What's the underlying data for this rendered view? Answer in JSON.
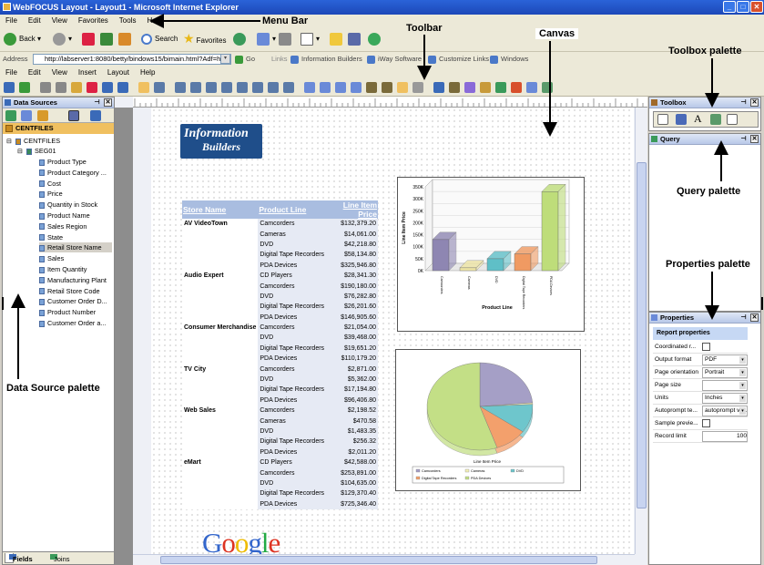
{
  "window": {
    "title": "WebFOCUS Layout - Layout1 - Microsoft Internet Explorer"
  },
  "ie_menu": [
    "File",
    "Edit",
    "View",
    "Favorites",
    "Tools",
    "Help"
  ],
  "ie_toolbar": {
    "back": "Back",
    "search": "Search",
    "favorites": "Favorites"
  },
  "address": {
    "label": "Address",
    "url": "http://labserver1:8080/betty/bindows15/bimain.html?Adf=ht",
    "go": "Go",
    "links_label": "Links",
    "links": [
      "Information Builders",
      "iWay Software",
      "Customize Links",
      "Windows"
    ]
  },
  "app_menu": [
    "File",
    "Edit",
    "View",
    "Insert",
    "Layout",
    "Help"
  ],
  "data_sources": {
    "title": "Data Sources",
    "root": "CENTFILES",
    "tree_root": "CENTFILES",
    "segment": "SEG01",
    "fields": [
      "Product Type",
      "Product Category ...",
      "Cost",
      "Price",
      "Quantity in Stock",
      "Product Name",
      "Sales Region",
      "State",
      "Retail Store Name",
      "Sales",
      "Item Quantity",
      "Manufacturing Plant",
      "Retail Store Code",
      "Customer Order D...",
      "Product Number",
      "Customer Order a..."
    ],
    "selected": "Retail Store Name",
    "tabs": [
      "Fields",
      "Joins"
    ]
  },
  "canvas": {
    "logo": {
      "line1": "Information",
      "line2": "Builders"
    },
    "google_logo": "Google",
    "report": {
      "headers": [
        "Store Name",
        "Product Line",
        "Line Item Price"
      ],
      "rows": [
        [
          "AV VideoTown",
          "Camcorders",
          "$132,379.20"
        ],
        [
          "",
          "Cameras",
          "$14,061.00"
        ],
        [
          "",
          "DVD",
          "$42,218.80"
        ],
        [
          "",
          "Digital Tape Recorders",
          "$58,134.80"
        ],
        [
          "",
          "PDA Devices",
          "$325,946.80"
        ],
        [
          "Audio Expert",
          "CD Players",
          "$28,341.30"
        ],
        [
          "",
          "Camcorders",
          "$190,180.00"
        ],
        [
          "",
          "DVD",
          "$76,282.80"
        ],
        [
          "",
          "Digital Tape Recorders",
          "$26,201.60"
        ],
        [
          "",
          "PDA Devices",
          "$146,905.60"
        ],
        [
          "Consumer Merchandise",
          "Camcorders",
          "$21,054.00"
        ],
        [
          "",
          "DVD",
          "$39,468.00"
        ],
        [
          "",
          "Digital Tape Recorders",
          "$19,651.20"
        ],
        [
          "",
          "PDA Devices",
          "$110,179.20"
        ],
        [
          "TV City",
          "Camcorders",
          "$2,871.00"
        ],
        [
          "",
          "DVD",
          "$5,362.00"
        ],
        [
          "",
          "Digital Tape Recorders",
          "$17,194.80"
        ],
        [
          "",
          "PDA Devices",
          "$96,406.80"
        ],
        [
          "Web Sales",
          "Camcorders",
          "$2,198.52"
        ],
        [
          "",
          "Cameras",
          "$470.58"
        ],
        [
          "",
          "DVD",
          "$1,483.35"
        ],
        [
          "",
          "Digital Tape Recorders",
          "$256.32"
        ],
        [
          "",
          "PDA Devices",
          "$2,011.20"
        ],
        [
          "eMart",
          "CD Players",
          "$42,588.00"
        ],
        [
          "",
          "Camcorders",
          "$253,891.00"
        ],
        [
          "",
          "DVD",
          "$104,635.00"
        ],
        [
          "",
          "Digital Tape Recorders",
          "$129,370.40"
        ],
        [
          "",
          "PDA Devices",
          "$725,346.40"
        ]
      ]
    }
  },
  "chart_data": [
    {
      "type": "bar",
      "categories": [
        "Camcorders",
        "Cameras",
        "DVD",
        "Digital Tape Recorders",
        "PDA Devices"
      ],
      "values": [
        130000,
        12000,
        50000,
        70000,
        330000
      ],
      "xlabel": "Product Line",
      "ylabel": "Line Item Price",
      "ylim": [
        0,
        350000
      ],
      "ticks": [
        "0K",
        "50K",
        "100K",
        "150K",
        "200K",
        "250K",
        "300K",
        "350K"
      ],
      "colors": [
        "#8e86b2",
        "#efe6a6",
        "#5fbfc7",
        "#f09a62",
        "#bedd7a"
      ]
    },
    {
      "type": "pie",
      "title": "Line Item Price",
      "categories": [
        "Camcorders",
        "Cameras",
        "DVD",
        "Digital Tape Recorders",
        "PDA Devices"
      ],
      "values": [
        602574,
        14532,
        269450,
        250809,
        1406796
      ],
      "legend": [
        "Camcorders",
        "Cameras",
        "DVD",
        "Digital Tape Recorders",
        "PDA Devices"
      ],
      "colors": [
        "#a59fc6",
        "#f4f0b8",
        "#6ec6cc",
        "#f3a06c",
        "#c3df86"
      ]
    }
  ],
  "toolbox": {
    "title": "Toolbox"
  },
  "query": {
    "title": "Query"
  },
  "properties": {
    "title": "Properties",
    "section": "Report properties",
    "rows": [
      {
        "label": "Coordinated r...",
        "value": ""
      },
      {
        "label": "Output format",
        "value": "PDF"
      },
      {
        "label": "Page orientation",
        "value": "Portrait"
      },
      {
        "label": "Page size",
        "value": ""
      },
      {
        "label": "Units",
        "value": "Inches"
      },
      {
        "label": "Autoprompt te...",
        "value": "autoprompt valu"
      },
      {
        "label": "Sample previe...",
        "value": ""
      },
      {
        "label": "Record limit",
        "value": "100"
      }
    ]
  },
  "annotations": {
    "menu_bar": "Menu Bar",
    "toolbar": "Toolbar",
    "canvas": "Canvas",
    "toolbox_palette": "Toolbox palette",
    "query_palette": "Query palette",
    "properties_palette": "Properties palette",
    "data_source_palette": "Data Source palette"
  }
}
